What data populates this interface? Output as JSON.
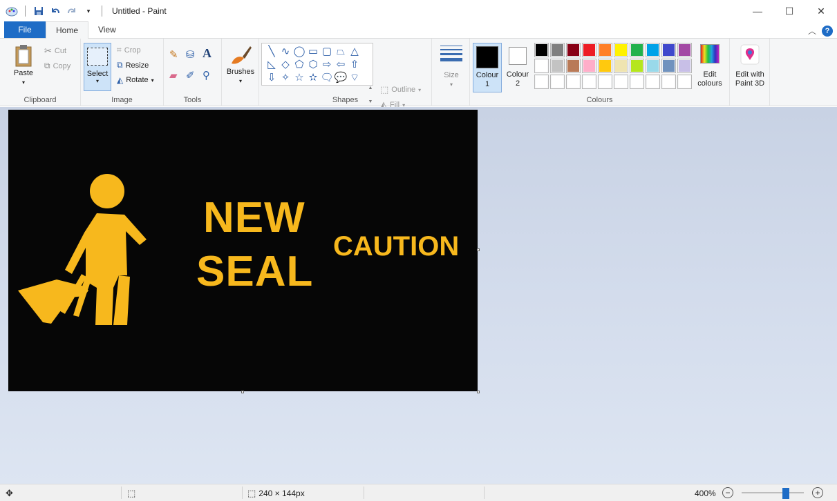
{
  "window": {
    "title": "Untitled - Paint",
    "minimize_glyph": "—",
    "maximize_glyph": "☐",
    "close_glyph": "✕"
  },
  "tabs": [
    {
      "label": "File"
    },
    {
      "label": "Home"
    },
    {
      "label": "View"
    }
  ],
  "ribbon": {
    "clipboard": {
      "label": "Clipboard",
      "paste": "Paste",
      "cut": "Cut",
      "copy": "Copy"
    },
    "image": {
      "label": "Image",
      "select": "Select",
      "crop": "Crop",
      "resize": "Resize",
      "rotate": "Rotate"
    },
    "tools": {
      "label": "Tools"
    },
    "brushes": {
      "label": "Brushes"
    },
    "shapes": {
      "label": "Shapes",
      "outline": "Outline",
      "fill": "Fill",
      "glyphs": [
        "╲",
        "∿",
        "◯",
        "▭",
        "▢",
        "⏢",
        "△",
        "◺",
        "◇",
        "⬠",
        "⬡",
        "⇨",
        "⇦",
        "⇧",
        "⇩",
        "✧",
        "☆",
        "✫",
        "🗨",
        "💬",
        "⌔"
      ]
    },
    "size": {
      "label": "Size"
    },
    "colour1": {
      "label_line1": "Colour",
      "label_line2": "1",
      "value": "#000000"
    },
    "colour2": {
      "label_line1": "Colour",
      "label_line2": "2",
      "value": "#ffffff"
    },
    "colours": {
      "label": "Colours",
      "row1": [
        "#000000",
        "#7f7f7f",
        "#880015",
        "#ed1c24",
        "#ff7f27",
        "#fff200",
        "#22b14c",
        "#00a2e8",
        "#3f48cc",
        "#a349a4"
      ],
      "row2": [
        "#ffffff",
        "#c3c3c3",
        "#b97a57",
        "#ffaec9",
        "#ffc90e",
        "#efe4b0",
        "#b5e61d",
        "#99d9ea",
        "#7092be",
        "#c8bfe7"
      ],
      "row3": [
        "#ffffff",
        "#ffffff",
        "#ffffff",
        "#ffffff",
        "#ffffff",
        "#ffffff",
        "#ffffff",
        "#ffffff",
        "#ffffff",
        "#ffffff"
      ]
    },
    "edit_colours": {
      "line1": "Edit",
      "line2": "colours"
    },
    "paint3d": {
      "line1": "Edit with",
      "line2": "Paint 3D"
    }
  },
  "canvas": {
    "background": "#060606",
    "text_color": "#f7b81d",
    "line_new": "NEW",
    "line_seal": "SEAL",
    "line_caution": "CAUTION"
  },
  "status": {
    "image_size": "240 × 144px",
    "zoom": "400%",
    "zoom_level": 0.8
  }
}
